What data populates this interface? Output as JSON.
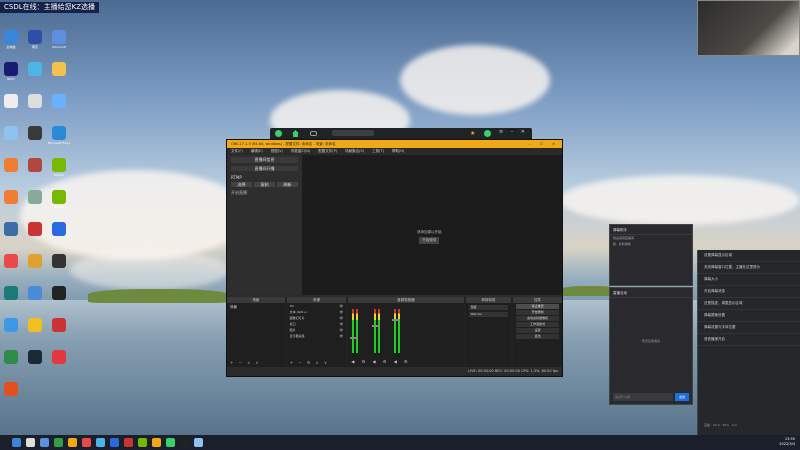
{
  "banner": "CSDL在线：主播给您KZ选播",
  "desktop_icons": [
    {
      "label": "此电脑",
      "color": "#3a86d8"
    },
    {
      "label": "网页",
      "color": "#2e4ea8"
    },
    {
      "label": "Microsoft",
      "color": "#5d8ee0"
    },
    {
      "label": "NEXT",
      "color": "#1a1a70"
    },
    {
      "label": "",
      "color": "#4eb4e8"
    },
    {
      "label": "",
      "color": "#f2c14e"
    },
    {
      "label": "",
      "color": "#eee"
    },
    {
      "label": "",
      "color": "#ddd"
    },
    {
      "label": "",
      "color": "#6ab0ff"
    },
    {
      "label": "",
      "color": "#8fc3ef"
    },
    {
      "label": "",
      "color": "#3a3a3a"
    },
    {
      "label": "Microsoft Edge",
      "color": "#2a8ad8"
    },
    {
      "label": "",
      "color": "#ef7d35"
    },
    {
      "label": "",
      "color": "#b04840"
    },
    {
      "label": "NVIDIA",
      "color": "#76b900"
    },
    {
      "label": "",
      "color": "#ef7d35"
    },
    {
      "label": "",
      "color": "#8a9"
    },
    {
      "label": "NVIDIA",
      "color": "#76b900"
    },
    {
      "label": "",
      "color": "#3b6ea8"
    },
    {
      "label": "",
      "color": "#c33"
    },
    {
      "label": "",
      "color": "#2a6ae0"
    },
    {
      "label": "",
      "color": "#e84a4a"
    },
    {
      "label": "",
      "color": "#e0a030"
    },
    {
      "label": "",
      "color": "#333"
    },
    {
      "label": "",
      "color": "#1a7a7a"
    },
    {
      "label": "",
      "color": "#4a8ad8"
    },
    {
      "label": "",
      "color": "#222"
    },
    {
      "label": "",
      "color": "#3a9ae8"
    },
    {
      "label": "",
      "color": "#f0c020"
    },
    {
      "label": "",
      "color": "#c33"
    },
    {
      "label": "",
      "color": "#2c8c4c"
    },
    {
      "label": "",
      "color": "#1b2838"
    },
    {
      "label": "",
      "color": "#e23a3a"
    },
    {
      "label": "",
      "color": "#e05020"
    }
  ],
  "obs": {
    "title": "OBS 27.1.3 (64-bit, windows) - 配置文件: 未命名 - 场景: 未命名",
    "menu": [
      "文件(F)",
      "编辑(E)",
      "视图(V)",
      "停靠窗口(D)",
      "配置文件(P)",
      "场景集合(S)",
      "工具(T)",
      "帮助(H)"
    ],
    "side_header": "直播间信息",
    "side_sub": "直播间开播",
    "side_label": "RTMP",
    "side_buttons": [
      "选择",
      "复制",
      "刷新"
    ],
    "side_link": "开启直播",
    "preview_line1": "请添加源以开始",
    "preview_line2": "开始使用",
    "mini_status": "未连接",
    "docks": {
      "scenes": "场景",
      "sources": "来源",
      "mixer": "音频混音器",
      "transitions": "转场特效",
      "controls": "控件"
    },
    "scene_item": "场景",
    "sources": [
      "2D",
      "文本 (GDI+)",
      "图像幻灯片",
      "窗口",
      "图片",
      "显示器采集"
    ],
    "transition_value": "渐变",
    "transition_duration": "300 ms",
    "controls": [
      "停止推流",
      "开始录制",
      "启动虚拟摄像机",
      "工作室模式",
      "设置",
      "退出"
    ],
    "status": "LIVE: 00:00:00   REC: 00:00:00   CPU: 1.3%, 60.00 fps"
  },
  "chat1": {
    "header": "弹幕助手",
    "lines": [
      "欢迎来到直播间",
      "我 · 好听哦哈"
    ]
  },
  "chat2": {
    "header": "直播互动",
    "lines": [
      "暂无互动消息"
    ],
    "input": "说点什么吧",
    "send": "发送"
  },
  "right_panel": {
    "items": [
      "设置弹幕显示区域",
      "关闭弹幕窗口位置，主播在这里提示",
      "弹幕大小",
      "开启弹幕消息",
      "这是描述，调整显示区域",
      "弹幕屏蔽设置",
      "弹幕设置与字体位置",
      "语音播报开启"
    ],
    "footer": "直播 · 00:0 · 95% · 0.0"
  },
  "taskbar": {
    "time": "13:55",
    "date": "2022/3/4"
  }
}
